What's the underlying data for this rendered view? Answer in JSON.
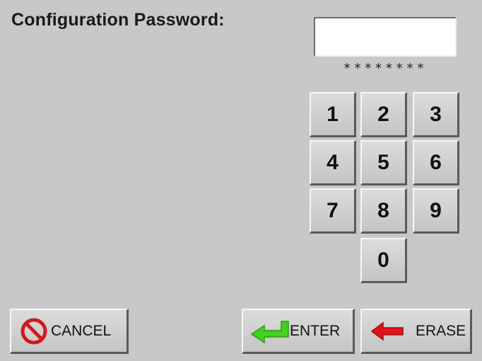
{
  "title": "Configuration Password:",
  "password": {
    "value": "",
    "mask": "********"
  },
  "keypad": {
    "keys": [
      "1",
      "2",
      "3",
      "4",
      "5",
      "6",
      "7",
      "8",
      "9",
      "0"
    ]
  },
  "buttons": {
    "cancel_label": "CANCEL",
    "enter_label": "ENTER",
    "erase_label": "ERASE"
  },
  "icons": {
    "cancel": "prohibited-icon",
    "enter": "enter-arrow-icon",
    "erase": "left-arrow-icon"
  },
  "colors": {
    "background": "#c8c8c8",
    "cancel_icon": "#d11a1a",
    "enter_icon": "#3fd21e",
    "erase_icon": "#e0141a"
  }
}
